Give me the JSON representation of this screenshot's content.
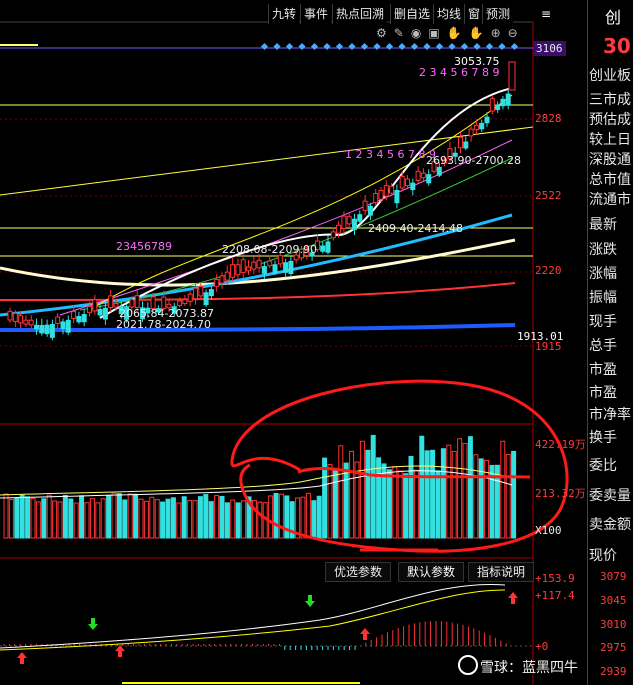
{
  "toolbar": {
    "buttons": [
      "九转",
      "事件",
      "热点回溯",
      "删自选",
      "均线",
      "窗",
      "预测"
    ],
    "stock_code_partial": "创"
  },
  "right_panel": {
    "top_price_partial": "30",
    "labels": [
      "创业板",
      "三市成",
      "预估成",
      "较上日",
      "深股通",
      "总市值",
      "流通市",
      "最新",
      "涨跌",
      "涨幅",
      "振幅",
      "现手",
      "总手",
      "市盈",
      "市盈",
      "市净率",
      "换手",
      "委比",
      "委卖量",
      "卖金额",
      "现价"
    ],
    "prices": [
      "3079",
      "3045",
      "3010",
      "2975",
      "2939"
    ]
  },
  "axis": {
    "price_ticks": [
      "3106",
      "2828",
      "2522",
      "2220",
      "1915"
    ],
    "price_low_label": "1913.01",
    "volume_ticks": [
      "422.19万",
      "213.32万",
      "X100"
    ],
    "macd_ticks": [
      "+153.9",
      "+117.4",
      "+0"
    ]
  },
  "annotations": {
    "high": "3053.75",
    "gaps": [
      "2693.90-2700.28",
      "2409.40-2414.48",
      "2208.08-2209.90",
      "2065.84-2073.87",
      "2021.78-2024.70"
    ],
    "td_counts_left": "23456789",
    "td_counts_mid": "1 2 3 4 5 6 7 8 9",
    "td_counts_right": "2 3 4 5 6 7 8 9"
  },
  "bottom_buttons": [
    "优选参数",
    "默认参数",
    "指标说明"
  ],
  "watermark": "雪球：蓝黑四牛",
  "colors": {
    "up": "#ff3333",
    "down": "#33e0e0",
    "ma_yellow": "#ffff00",
    "ma_white": "#ffffff",
    "ma_blue": "#1e90ff",
    "annot": "#ff1a1a"
  }
}
